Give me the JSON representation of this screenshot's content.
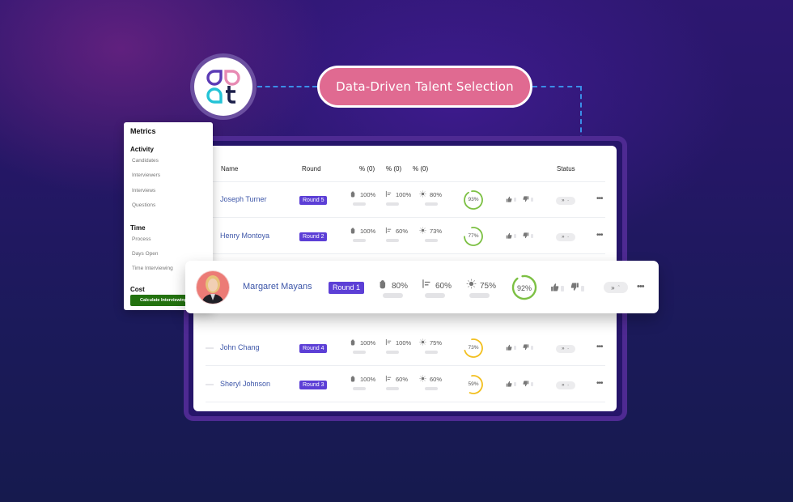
{
  "banner": {
    "title": "Data-Driven Talent Selection",
    "logo_letters": [
      "a",
      "a",
      "a",
      "t"
    ],
    "colors": {
      "pill": "#e06a91",
      "connector": "#3b8ee8",
      "logo_purple": "#5b3bb5",
      "logo_pink": "#e78ab3",
      "logo_cyan": "#23c3d6",
      "logo_navy": "#1b1f4a"
    }
  },
  "sidebar": {
    "title": "Metrics",
    "sections": [
      {
        "heading": "Activity",
        "items": [
          "Candidates",
          "Interviewers",
          "Interviews",
          "Questions"
        ]
      },
      {
        "heading": "Time",
        "items": [
          "Process",
          "Days Open",
          "Time Interviewing"
        ]
      },
      {
        "heading": "Cost",
        "items": []
      }
    ],
    "button_label": "Calculate Interviewing"
  },
  "table": {
    "headers": {
      "name": "Name",
      "round": "Round",
      "m1": "% (0)",
      "m2": "% (0)",
      "m3": "% (0)",
      "status": "Status"
    },
    "rows": [
      {
        "name": "Joseph Turner",
        "round": "Round 5",
        "m1": "100%",
        "m2": "100%",
        "m3": "80%",
        "score": "93%",
        "score_value": 93,
        "score_color": "#7cc043",
        "status": "»"
      },
      {
        "name": "Henry Montoya",
        "round": "Round 2",
        "m1": "100%",
        "m2": "60%",
        "m3": "73%",
        "score": "77%",
        "score_value": 77,
        "score_color": "#7cc043",
        "status": "»"
      },
      {
        "name": "John Chang",
        "round": "Round 4",
        "m1": "100%",
        "m2": "100%",
        "m3": "75%",
        "score": "73%",
        "score_value": 73,
        "score_color": "#f2bf1e",
        "status": "»"
      },
      {
        "name": "Sheryl Johnson",
        "round": "Round 3",
        "m1": "100%",
        "m2": "60%",
        "m3": "60%",
        "score": "59%",
        "score_value": 59,
        "score_color": "#f2bf1e",
        "status": "»"
      }
    ],
    "highlighted": {
      "name": "Margaret Mayans",
      "round": "Round 1",
      "m1": "80%",
      "m2": "60%",
      "m3": "75%",
      "score": "92%",
      "score_value": 92,
      "score_color": "#7cc043",
      "status": "»"
    },
    "more_label": "•••",
    "status_caret": "⌃⌄"
  },
  "icons": {
    "metric1": "hand-icon",
    "metric2": "align-left-icon",
    "metric3": "sun-icon",
    "up": "thumbs-up-icon",
    "down": "thumbs-down-icon"
  }
}
